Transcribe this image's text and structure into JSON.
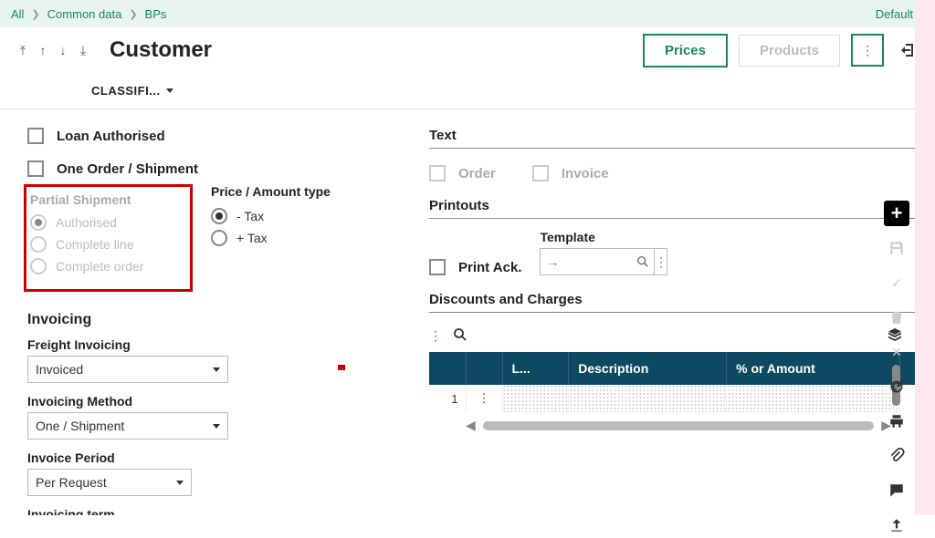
{
  "breadcrumb": {
    "items": [
      "All",
      "Common data",
      "BPs"
    ],
    "right_label": "Default"
  },
  "header": {
    "title": "Customer",
    "prices_btn": "Prices",
    "products_btn": "Products"
  },
  "tabs": {
    "classifi": "CLASSIFI..."
  },
  "left": {
    "loan_authorised": "Loan Authorised",
    "one_order_shipment": "One Order / Shipment",
    "partial_shipment_title": "Partial Shipment",
    "partial_opts": [
      "Authorised",
      "Complete line",
      "Complete order"
    ],
    "price_amount_title": "Price / Amount type",
    "price_opts": [
      "- Tax",
      "+ Tax"
    ],
    "invoicing_title": "Invoicing",
    "freight_label": "Freight Invoicing",
    "freight_value": "Invoiced",
    "inv_method_label": "Invoicing Method",
    "inv_method_value": "One / Shipment",
    "inv_period_label": "Invoice Period",
    "inv_period_value": "Per Request",
    "inv_term_label": "Invoicing term"
  },
  "right": {
    "text_label": "Text",
    "order_label": "Order",
    "invoice_label": "Invoice",
    "printouts_title": "Printouts",
    "print_ack_label": "Print Ack.",
    "template_label": "Template",
    "discounts_title": "Discounts and Charges",
    "grid": {
      "cols": [
        "",
        "",
        "L...",
        "Description",
        "% or Amount",
        ""
      ],
      "row1_num": "1"
    }
  }
}
